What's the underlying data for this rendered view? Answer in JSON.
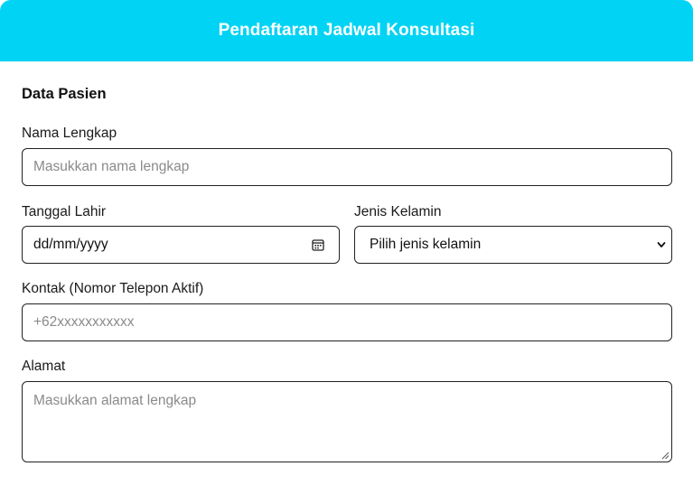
{
  "header": {
    "title": "Pendaftaran Jadwal Konsultasi"
  },
  "section": {
    "title": "Data Pasien"
  },
  "fields": {
    "nama": {
      "label": "Nama Lengkap",
      "placeholder": "Masukkan nama lengkap",
      "value": ""
    },
    "tanggal_lahir": {
      "label": "Tanggal Lahir",
      "display": "dd/mm/yyyy",
      "icon": "calendar-icon"
    },
    "jenis_kelamin": {
      "label": "Jenis Kelamin",
      "selected": "Pilih jenis kelamin",
      "icon": "chevron-down-icon"
    },
    "kontak": {
      "label": "Kontak (Nomor Telepon Aktif)",
      "placeholder": "+62xxxxxxxxxxx",
      "value": ""
    },
    "alamat": {
      "label": "Alamat",
      "placeholder": "Masukkan alamat lengkap",
      "value": ""
    }
  },
  "colors": {
    "header_bg": "#00d3f3",
    "header_text": "#ffffff",
    "border": "#222222",
    "placeholder": "#8a8a8a"
  }
}
